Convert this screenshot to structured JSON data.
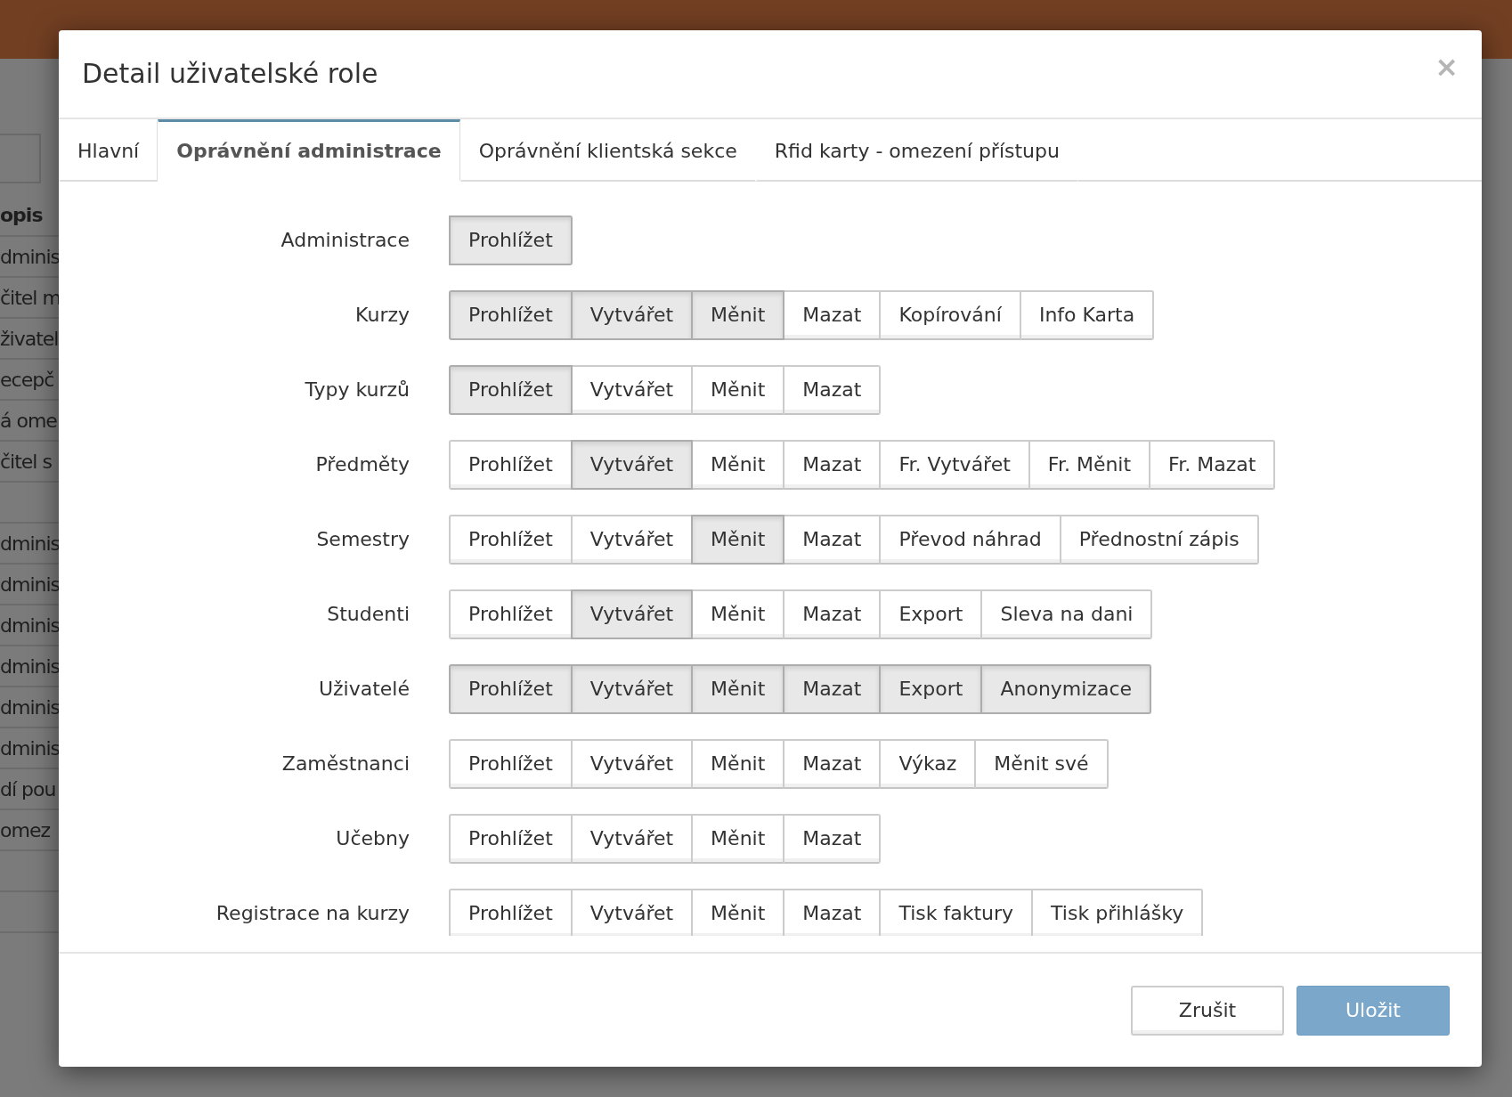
{
  "background": {
    "column_header": "opis",
    "rows_top": [
      "dminis",
      "čitel m",
      "živatel",
      "ecepč",
      "á ome",
      "čitel s"
    ],
    "rows_bottom": [
      "dminis",
      "dminis",
      "dminis",
      "dminis",
      "dminis",
      "dminis",
      "dí pou",
      "omez"
    ]
  },
  "dialog": {
    "title": "Detail uživatelské role",
    "close": "×",
    "tabs": [
      {
        "label": "Hlavní",
        "selected": false
      },
      {
        "label": "Oprávnění administrace",
        "selected": true
      },
      {
        "label": "Oprávnění klientská sekce",
        "selected": false
      },
      {
        "label": "Rfid karty - omezení přístupu",
        "selected": false
      }
    ],
    "permissions": [
      {
        "label": "Administrace",
        "options": [
          {
            "label": "Prohlížet",
            "selected": true
          }
        ]
      },
      {
        "label": "Kurzy",
        "options": [
          {
            "label": "Prohlížet",
            "selected": true
          },
          {
            "label": "Vytvářet",
            "selected": true
          },
          {
            "label": "Měnit",
            "selected": true
          },
          {
            "label": "Mazat",
            "selected": false
          },
          {
            "label": "Kopírování",
            "selected": false
          },
          {
            "label": "Info Karta",
            "selected": false
          }
        ]
      },
      {
        "label": "Typy kurzů",
        "options": [
          {
            "label": "Prohlížet",
            "selected": true
          },
          {
            "label": "Vytvářet",
            "selected": false
          },
          {
            "label": "Měnit",
            "selected": false
          },
          {
            "label": "Mazat",
            "selected": false
          }
        ]
      },
      {
        "label": "Předměty",
        "options": [
          {
            "label": "Prohlížet",
            "selected": false
          },
          {
            "label": "Vytvářet",
            "selected": true
          },
          {
            "label": "Měnit",
            "selected": false
          },
          {
            "label": "Mazat",
            "selected": false
          },
          {
            "label": "Fr. Vytvářet",
            "selected": false
          },
          {
            "label": "Fr. Měnit",
            "selected": false
          },
          {
            "label": "Fr. Mazat",
            "selected": false
          }
        ]
      },
      {
        "label": "Semestry",
        "options": [
          {
            "label": "Prohlížet",
            "selected": false
          },
          {
            "label": "Vytvářet",
            "selected": false
          },
          {
            "label": "Měnit",
            "selected": true
          },
          {
            "label": "Mazat",
            "selected": false
          },
          {
            "label": "Převod náhrad",
            "selected": false
          },
          {
            "label": "Přednostní zápis",
            "selected": false
          }
        ]
      },
      {
        "label": "Studenti",
        "options": [
          {
            "label": "Prohlížet",
            "selected": false
          },
          {
            "label": "Vytvářet",
            "selected": true
          },
          {
            "label": "Měnit",
            "selected": false
          },
          {
            "label": "Mazat",
            "selected": false
          },
          {
            "label": "Export",
            "selected": false
          },
          {
            "label": "Sleva na dani",
            "selected": false
          }
        ]
      },
      {
        "label": "Uživatelé",
        "options": [
          {
            "label": "Prohlížet",
            "selected": true
          },
          {
            "label": "Vytvářet",
            "selected": true
          },
          {
            "label": "Měnit",
            "selected": true
          },
          {
            "label": "Mazat",
            "selected": true
          },
          {
            "label": "Export",
            "selected": true
          },
          {
            "label": "Anonymizace",
            "selected": true
          }
        ]
      },
      {
        "label": "Zaměstnanci",
        "options": [
          {
            "label": "Prohlížet",
            "selected": false
          },
          {
            "label": "Vytvářet",
            "selected": false
          },
          {
            "label": "Měnit",
            "selected": false
          },
          {
            "label": "Mazat",
            "selected": false
          },
          {
            "label": "Výkaz",
            "selected": false
          },
          {
            "label": "Měnit své",
            "selected": false
          }
        ]
      },
      {
        "label": "Učebny",
        "options": [
          {
            "label": "Prohlížet",
            "selected": false
          },
          {
            "label": "Vytvářet",
            "selected": false
          },
          {
            "label": "Měnit",
            "selected": false
          },
          {
            "label": "Mazat",
            "selected": false
          }
        ]
      },
      {
        "label": "Registrace na kurzy",
        "options": [
          {
            "label": "Prohlížet",
            "selected": false
          },
          {
            "label": "Vytvářet",
            "selected": false
          },
          {
            "label": "Měnit",
            "selected": false
          },
          {
            "label": "Mazat",
            "selected": false
          },
          {
            "label": "Tisk faktury",
            "selected": false
          },
          {
            "label": "Tisk přihlášky",
            "selected": false
          }
        ]
      }
    ],
    "buttons": [
      {
        "label": "Zrušit",
        "kind": "secondary"
      },
      {
        "label": "Uložit",
        "kind": "primary"
      }
    ]
  }
}
